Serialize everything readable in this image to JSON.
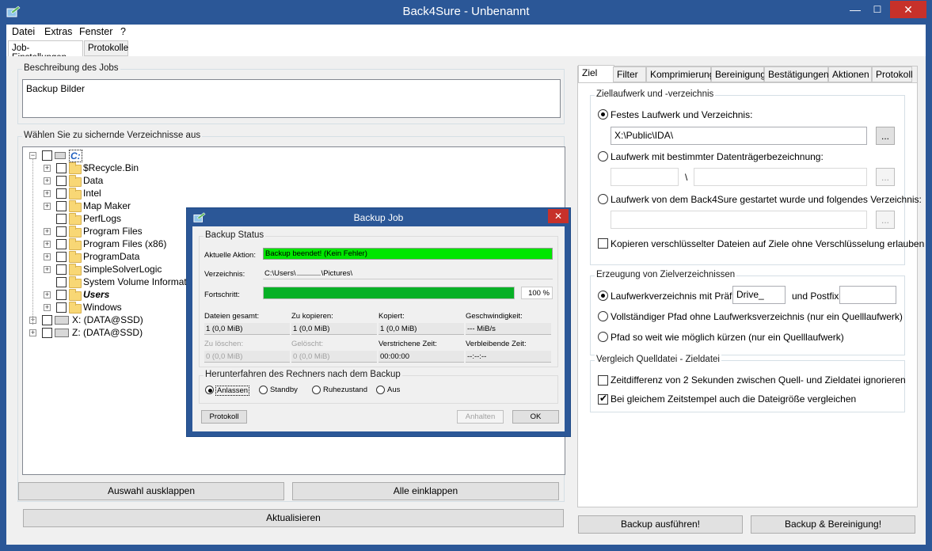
{
  "window": {
    "title": "Back4Sure - Unbenannt",
    "minimize": "—",
    "maximize": "☐",
    "close": "✕"
  },
  "menu": [
    "Datei",
    "Extras",
    "Fenster",
    "?"
  ],
  "main_tabs": [
    "Job-Einstellungen",
    "Protokolle"
  ],
  "description": {
    "label": "Beschreibung des Jobs",
    "value": "Backup Bilder"
  },
  "tree": {
    "label": "Wählen Sie zu sichernde Verzeichnisse aus",
    "root": "C:",
    "items": [
      "$Recycle.Bin",
      "Data",
      "Intel",
      "Map Maker",
      "PerfLogs",
      "Program Files",
      "Program Files (x86)",
      "ProgramData",
      "SimpleSolverLogic",
      "System Volume Information",
      "Users",
      "Windows"
    ],
    "drives": [
      "X: (DATA@SSD)",
      "Z: (DATA@SSD)"
    ]
  },
  "left_buttons": {
    "expand": "Auswahl ausklappen",
    "collapse": "Alle einklappen",
    "refresh": "Aktualisieren"
  },
  "right_tabs": [
    "Ziel",
    "Filter",
    "Komprimierung",
    "Bereinigung",
    "Bestätigungen",
    "Aktionen",
    "Protokoll"
  ],
  "target": {
    "group_label": "Ziellaufwerk und -verzeichnis",
    "option1": "Festes Laufwerk und Verzeichnis:",
    "path": "X:\\Public\\IDA\\",
    "browse": "...",
    "option2": "Laufwerk mit bestimmter Datenträgerbezeichnung:",
    "separator": "\\",
    "option3": "Laufwerk von dem Back4Sure gestartet wurde und folgendes Verzeichnis:",
    "copy_encrypted": "Kopieren verschlüsselter Dateien auf Ziele ohne Verschlüsselung erlauben"
  },
  "dirs": {
    "group_label": "Erzeugung von Zielverzeichnissen",
    "opt_prefix": "Laufwerkverzeichnis mit Präfix",
    "prefix_value": "Drive_",
    "postfix_label": "und Postfix",
    "opt_full": "Vollständiger Pfad ohne Laufwerksverzeichnis (nur ein Quelllaufwerk)",
    "opt_short": "Pfad so weit wie möglich kürzen (nur ein Quelllaufwerk)"
  },
  "compare": {
    "group_label": "Vergleich Quelldatei - Zieldatei",
    "opt_time": "Zeitdifferenz von 2 Sekunden zwischen Quell- und Zieldatei ignorieren",
    "opt_size": "Bei gleichem Zeitstempel auch die Dateigröße vergleichen"
  },
  "right_buttons": {
    "run": "Backup ausführen!",
    "run_clean": "Backup & Bereinigung!"
  },
  "dialog": {
    "title": "Backup Job",
    "close": "✕",
    "status_label": "Backup Status",
    "action_label": "Aktuelle Aktion:",
    "action_value": "Backup beendet! (Kein Fehler)",
    "dir_label": "Verzeichnis:",
    "dir_value": "C:\\Users\\",
    "dir_value2": "\\Pictures\\",
    "progress_label": "Fortschritt:",
    "progress_value": "100 %",
    "progress_fraction": 1.0,
    "stats": [
      {
        "label": "Dateien gesamt:",
        "value": "1 (0,0 MiB)"
      },
      {
        "label": "Zu kopieren:",
        "value": "1 (0,0 MiB)"
      },
      {
        "label": "Kopiert:",
        "value": "1 (0,0 MiB)"
      },
      {
        "label": "Geschwindigkeit:",
        "value": "--- MiB/s"
      },
      {
        "label": "Zu löschen:",
        "value": "0 (0,0 MiB)"
      },
      {
        "label": "Gelöscht:",
        "value": "0 (0,0 MiB)"
      },
      {
        "label": "Verstrichene Zeit:",
        "value": "00:00:00"
      },
      {
        "label": "Verbleibende Zeit:",
        "value": "--:--:--"
      }
    ],
    "shutdown_label": "Herunterfahren des Rechners nach dem Backup",
    "shutdown_options": [
      "Anlassen",
      "Standby",
      "Ruhezustand",
      "Aus"
    ],
    "btn_log": "Protokoll",
    "btn_pause": "Anhalten",
    "btn_ok": "OK"
  },
  "colors": {
    "titlebar": "#2b5797",
    "close": "#c7312a",
    "progress_green": "#00e600"
  }
}
